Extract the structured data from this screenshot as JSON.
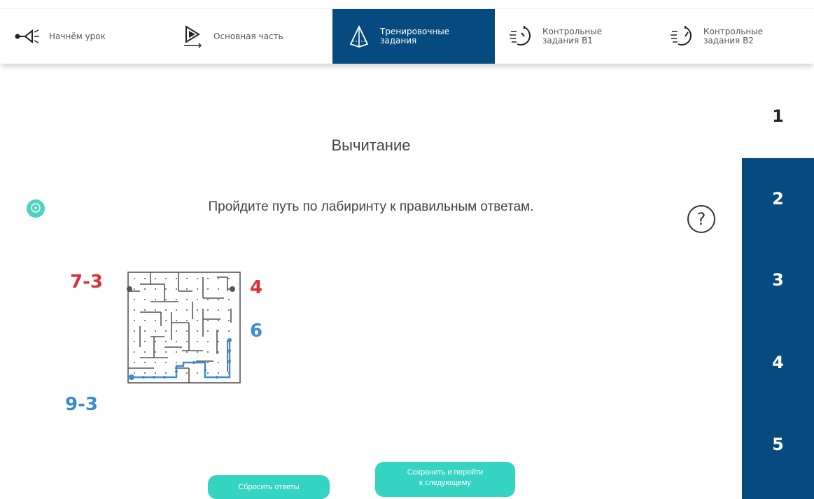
{
  "nav": {
    "tabs": [
      {
        "label": "Начнём урок",
        "icon": "flashlight-icon"
      },
      {
        "label": "Основная часть",
        "icon": "play-icon"
      },
      {
        "label": "Тренировочные\nзадания",
        "icon": "pyramid-icon"
      },
      {
        "label": "Контрольные\nзадания В1",
        "icon": "timer-icon"
      },
      {
        "label": "Контрольные\nзадания В2",
        "icon": "timer-icon"
      }
    ]
  },
  "main": {
    "title": "Вычитание",
    "instruction": "Пройдите путь по лабиринту к правильным ответам.",
    "help_label": "?"
  },
  "maze": {
    "labels": {
      "top_left": "7-3",
      "top_right": "4",
      "middle_right": "6",
      "bottom_left": "9-3"
    }
  },
  "pages": [
    "1",
    "2",
    "3",
    "4",
    "5"
  ],
  "buttons": {
    "reset": "Сбросить ответы",
    "save_next": "Сохранить и перейти\nк следующему"
  },
  "colors": {
    "accent": "#064b80",
    "teal": "#35d3c1",
    "red": "#d9303a",
    "blue": "#3a8ad6"
  }
}
